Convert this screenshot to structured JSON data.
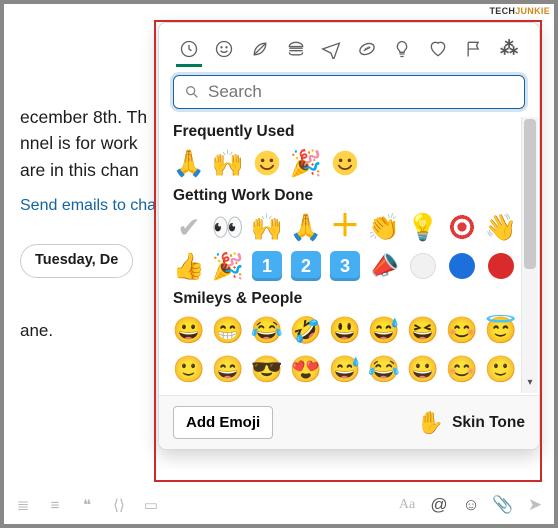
{
  "watermark": {
    "brand_a": "TECH",
    "brand_b": "JUNKIE"
  },
  "chat": {
    "line1": "ecember 8th. Th",
    "line2": "nnel is for work",
    "line3": " are in this chan",
    "link": "Send emails to cha",
    "date_pill": "Tuesday, De",
    "ane": "ane."
  },
  "picker": {
    "tabs": [
      "clock-icon",
      "smiley-icon",
      "leaf-icon",
      "burger-icon",
      "plane-icon",
      "football-icon",
      "bulb-icon",
      "heart-icon",
      "flag-icon",
      "slack-icon"
    ],
    "search": {
      "placeholder": "Search"
    },
    "sections": {
      "frequent": {
        "title": "Frequently Used",
        "emojis": [
          "pray",
          "raised-hands",
          "smile",
          "tada",
          "smile"
        ]
      },
      "work": {
        "title": "Getting Work Done",
        "row1": [
          "check",
          "eyes",
          "raised-hands",
          "pray",
          "plus",
          "clap",
          "bulb",
          "target",
          "wave"
        ],
        "row2": [
          "thumbs-up",
          "tada",
          "num-1",
          "num-2",
          "num-3",
          "megaphone",
          "circle-white",
          "circle-blue",
          "circle-red"
        ]
      },
      "smileys": {
        "title": "Smileys & People",
        "row1": [
          "grin",
          "beam",
          "joy",
          "rofl",
          "smile-big",
          "sweat-smile",
          "laugh",
          "blush",
          "halo"
        ],
        "row2": [
          "smile",
          "grin-big",
          "sunglasses",
          "heart-eyes",
          "sweat-smile",
          "joy",
          "grin",
          "blush",
          "smile"
        ]
      }
    },
    "footer": {
      "add": "Add Emoji",
      "skin": "Skin Tone",
      "skin_hand": "✋"
    }
  },
  "composer": {
    "left": [
      "list-icon",
      "numbered-list-icon",
      "quote-icon",
      "code-icon",
      "codeblock-icon"
    ],
    "right": [
      "aa-icon",
      "mention-icon",
      "emoji-icon",
      "attach-icon",
      "send-icon"
    ]
  }
}
